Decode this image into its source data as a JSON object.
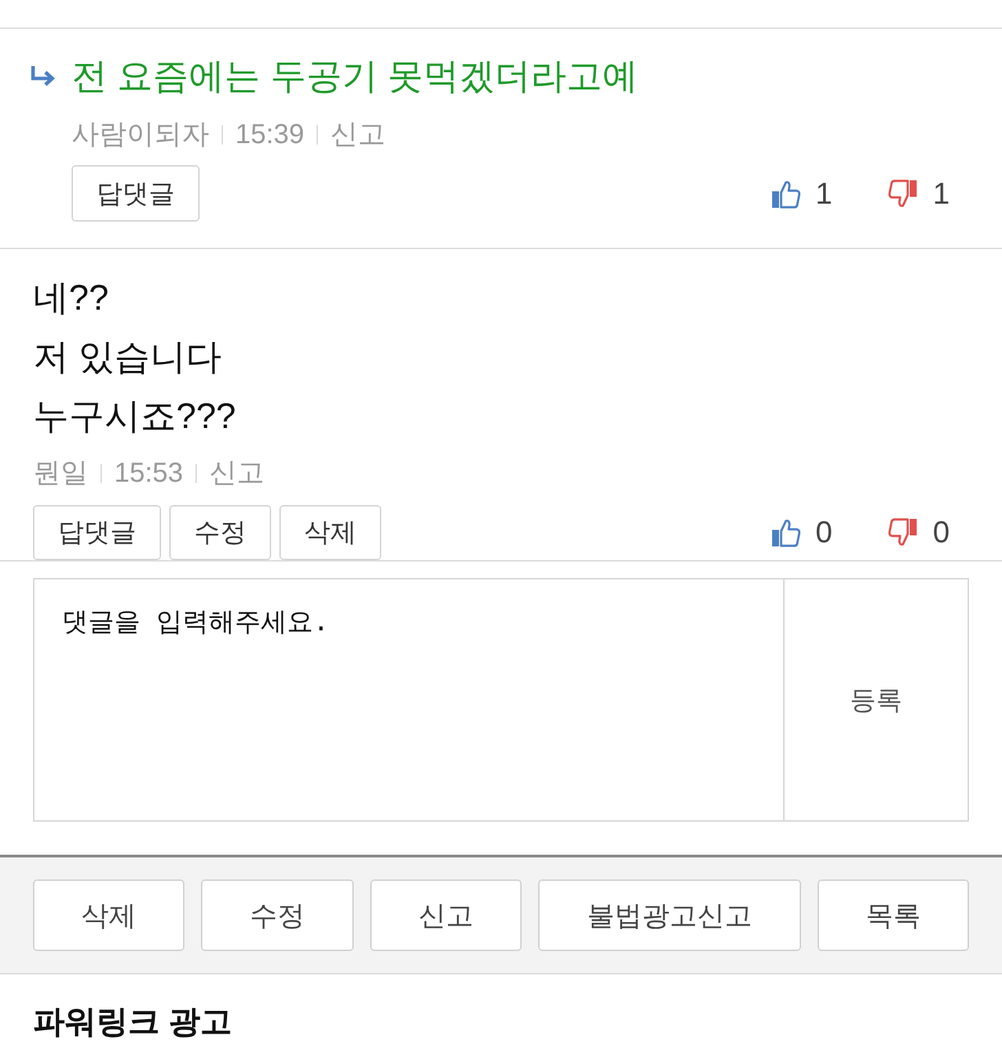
{
  "comments": [
    {
      "kind": "reply",
      "lines": [
        "전 요즘에는 두공기 못먹겠더라고예"
      ],
      "author": "사람이되자",
      "time": "15:39",
      "report": "신고",
      "buttons": [
        "답댓글"
      ],
      "likes": "1",
      "dislikes": "1"
    },
    {
      "kind": "comment",
      "lines": [
        "네??",
        "저 있습니다",
        "누구시죠???"
      ],
      "author": "뭔일",
      "time": "15:53",
      "report": "신고",
      "buttons": [
        "답댓글",
        "수정",
        "삭제"
      ],
      "likes": "0",
      "dislikes": "0"
    }
  ],
  "comment_form": {
    "placeholder": "댓글을 입력해주세요.",
    "submit": "등록"
  },
  "actions": [
    "삭제",
    "수정",
    "신고",
    "불법광고신고",
    "목록"
  ],
  "ad_section": {
    "title": "파워링크 광고"
  }
}
